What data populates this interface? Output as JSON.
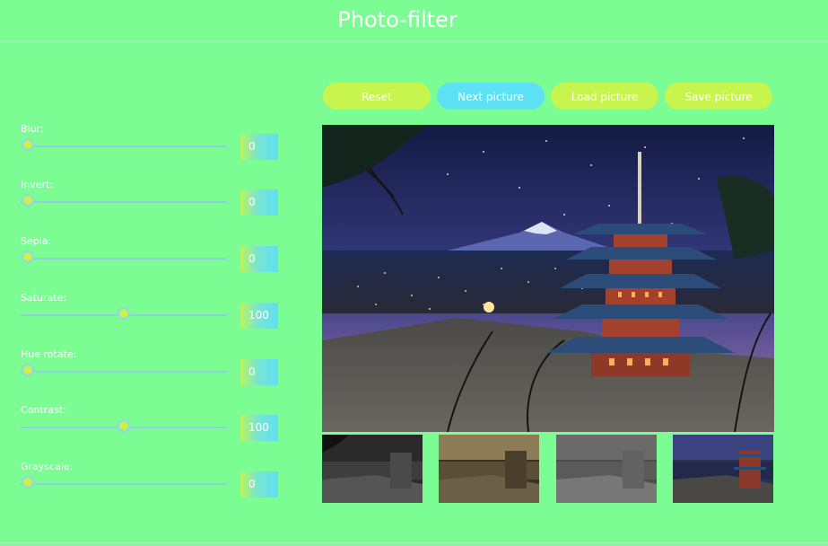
{
  "app": {
    "title": "Photo-filter"
  },
  "controls": [
    {
      "label": "Blur:",
      "value": "0",
      "level": 0
    },
    {
      "label": "Invert:",
      "value": "0",
      "level": 0
    },
    {
      "label": "Sepia:",
      "value": "0",
      "level": 0
    },
    {
      "label": "Saturate:",
      "value": "100",
      "level": 0.5
    },
    {
      "label": "Hue rotate:",
      "value": "0",
      "level": 0
    },
    {
      "label": "Contrast:",
      "value": "100",
      "level": 0.5
    },
    {
      "label": "Grayscale:",
      "value": "0",
      "level": 0
    }
  ],
  "buttons": {
    "reset": "Reset",
    "next": "Next picture",
    "load": "Load picture",
    "save": "Save picture"
  },
  "colors": {
    "background": "#7bfd93",
    "button_lime": "#c8f54d",
    "button_cyan": "#5ee0f5",
    "thumb": "#c6f24a"
  }
}
